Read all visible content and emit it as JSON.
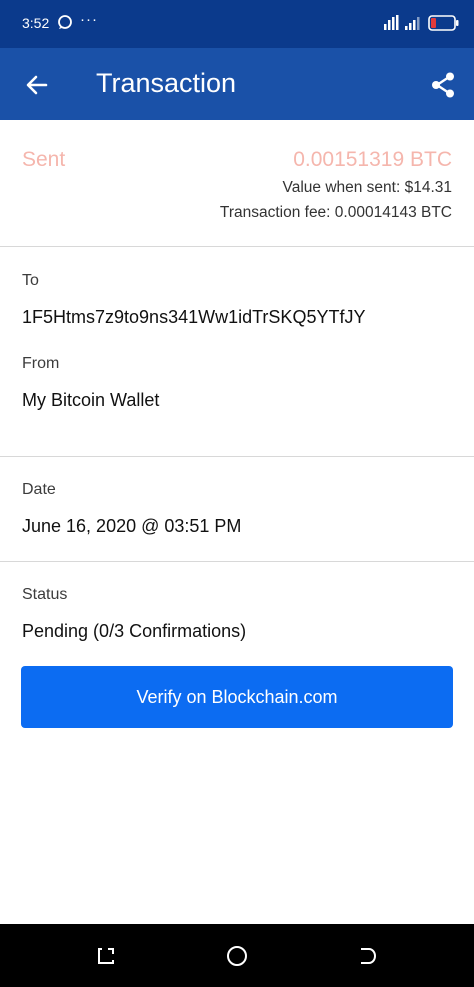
{
  "status_bar": {
    "time": "3:52",
    "dots": "···",
    "icons": [
      "chat-bubble-icon",
      "signal-icon",
      "battery-icon"
    ]
  },
  "header": {
    "title": "Transaction",
    "back_icon": "arrow-left-icon",
    "share_icon": "share-icon",
    "background": "#1a51a8",
    "status_background": "#0b3a8c"
  },
  "summary": {
    "direction": "Sent",
    "amount": "0.00151319 BTC",
    "value_when_sent": "Value when sent: $14.31",
    "transaction_fee": "Transaction fee: 0.00014143 BTC",
    "accent_color": "#f5b6ad"
  },
  "details": {
    "to_label": "To",
    "to_value": "1F5Htms7z9to9ns341Ww1idTrSKQ5YTfJY",
    "from_label": "From",
    "from_value": "My Bitcoin Wallet",
    "date_label": "Date",
    "date_value": "June 16, 2020 @ 03:51 PM",
    "status_label": "Status",
    "status_value": "Pending (0/3 Confirmations)"
  },
  "verify_button": {
    "label": "Verify on Blockchain.com",
    "color": "#0c6cf2"
  },
  "nav_bar": {
    "icons": [
      "recents-icon",
      "home-icon",
      "back-icon"
    ]
  }
}
